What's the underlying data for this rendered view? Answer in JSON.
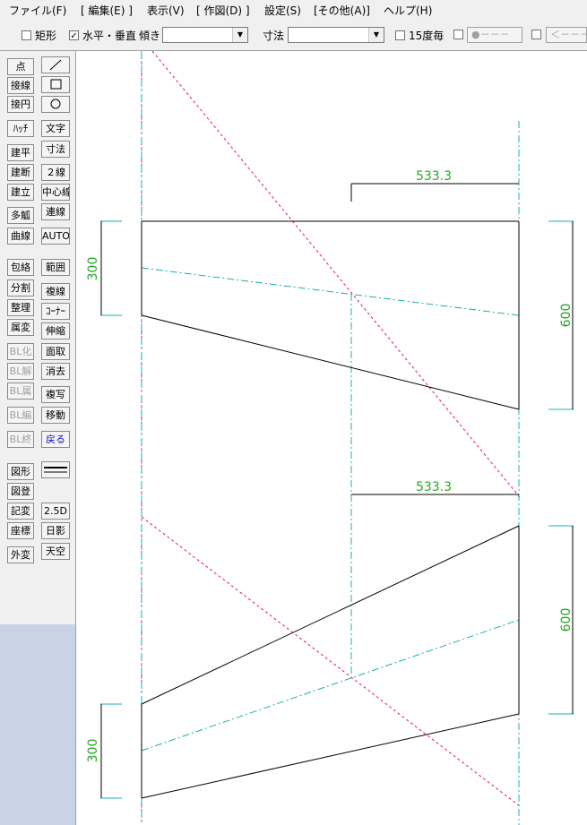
{
  "menu": {
    "items": [
      "ファイル(F)",
      "[ 編集(E) ]",
      "表示(V)",
      "[ 作図(D) ]",
      "設定(S)",
      "[その他(A)]",
      "ヘルプ(H)"
    ]
  },
  "toolbar": {
    "rect_label": "矩形",
    "hv_label": "水平・垂直",
    "slope_label": "傾き",
    "dim_label": "寸法",
    "deg15_label": "15度毎",
    "point_pill": "●－－－",
    "arrow_pill": "＜－－－"
  },
  "sidebar": {
    "col1a": [
      "点",
      "接線",
      "接円",
      "ﾊｯﾁ",
      "建平",
      "建断",
      "建立",
      "多觚",
      "曲線"
    ],
    "col2a": [
      "文字",
      "寸法",
      "２線",
      "中心線",
      "連線",
      "AUTO"
    ],
    "col1b": [
      "包絡",
      "分割",
      "整理",
      "属変",
      "BL化",
      "BL解",
      "BL属",
      "BL編",
      "BL終"
    ],
    "col2b": [
      "範囲",
      "複線",
      "ｺｰﾅｰ",
      "伸縮",
      "面取",
      "消去",
      "複写",
      "移動",
      "戻る"
    ],
    "col1c": [
      "図形",
      "図登",
      "記変",
      "座標",
      "外変"
    ],
    "col2c": [
      "2.5D",
      "日影",
      "天空"
    ],
    "line_icon": "line-tool-icon",
    "rect_icon": "rectangle-tool-icon",
    "circle_icon": "circle-tool-icon"
  },
  "canvas": {
    "dims": [
      "533.3",
      "533.3",
      "300",
      "600",
      "600",
      "300"
    ],
    "colors": {
      "solid": "#000000",
      "center": "#1ab0b0",
      "aux": "#e0107a",
      "dim_text": "#22aa22"
    }
  }
}
